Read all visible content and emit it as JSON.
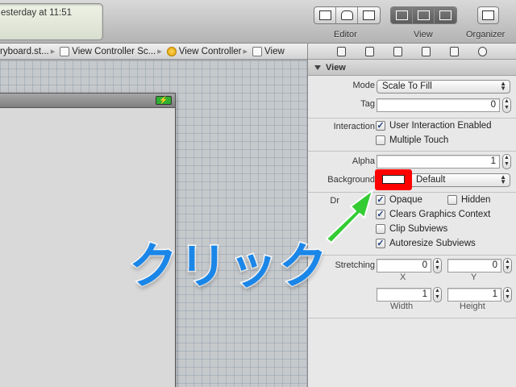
{
  "toolbar": {
    "activity_text": "esterday at 11:51",
    "editor_label": "Editor",
    "view_label": "View",
    "organizer_label": "Organizer"
  },
  "jumpbar": {
    "crumbs": [
      "ryboard.st...",
      "View Controller Sc...",
      "View Controller",
      "View"
    ]
  },
  "inspector": {
    "section_title": "View",
    "mode_label": "Mode",
    "mode_value": "Scale To Fill",
    "tag_label": "Tag",
    "tag_value": "0",
    "interaction_label": "Interaction",
    "user_interaction": "User Interaction Enabled",
    "multiple_touch": "Multiple Touch",
    "alpha_label": "Alpha",
    "alpha_value": "1",
    "background_label": "Background",
    "background_value": "Default",
    "drawing_label": "Dr",
    "opaque": "Opaque",
    "hidden": "Hidden",
    "clears_graphics": "Clears Graphics Context",
    "clip_subviews": "Clip Subviews",
    "autoresize": "Autoresize Subviews",
    "stretching_label": "Stretching",
    "stretch_x_value": "0",
    "stretch_y_value": "0",
    "x_label": "X",
    "y_label": "Y",
    "stretch_w_value": "1",
    "stretch_h_value": "1",
    "width_label": "Width",
    "height_label": "Height"
  },
  "annotation": {
    "text": "クリック",
    "highlight_color": "#ff0000",
    "arrow_color": "#33cc33",
    "text_color": "#1a86e8"
  },
  "checkbox_mark": "✓"
}
